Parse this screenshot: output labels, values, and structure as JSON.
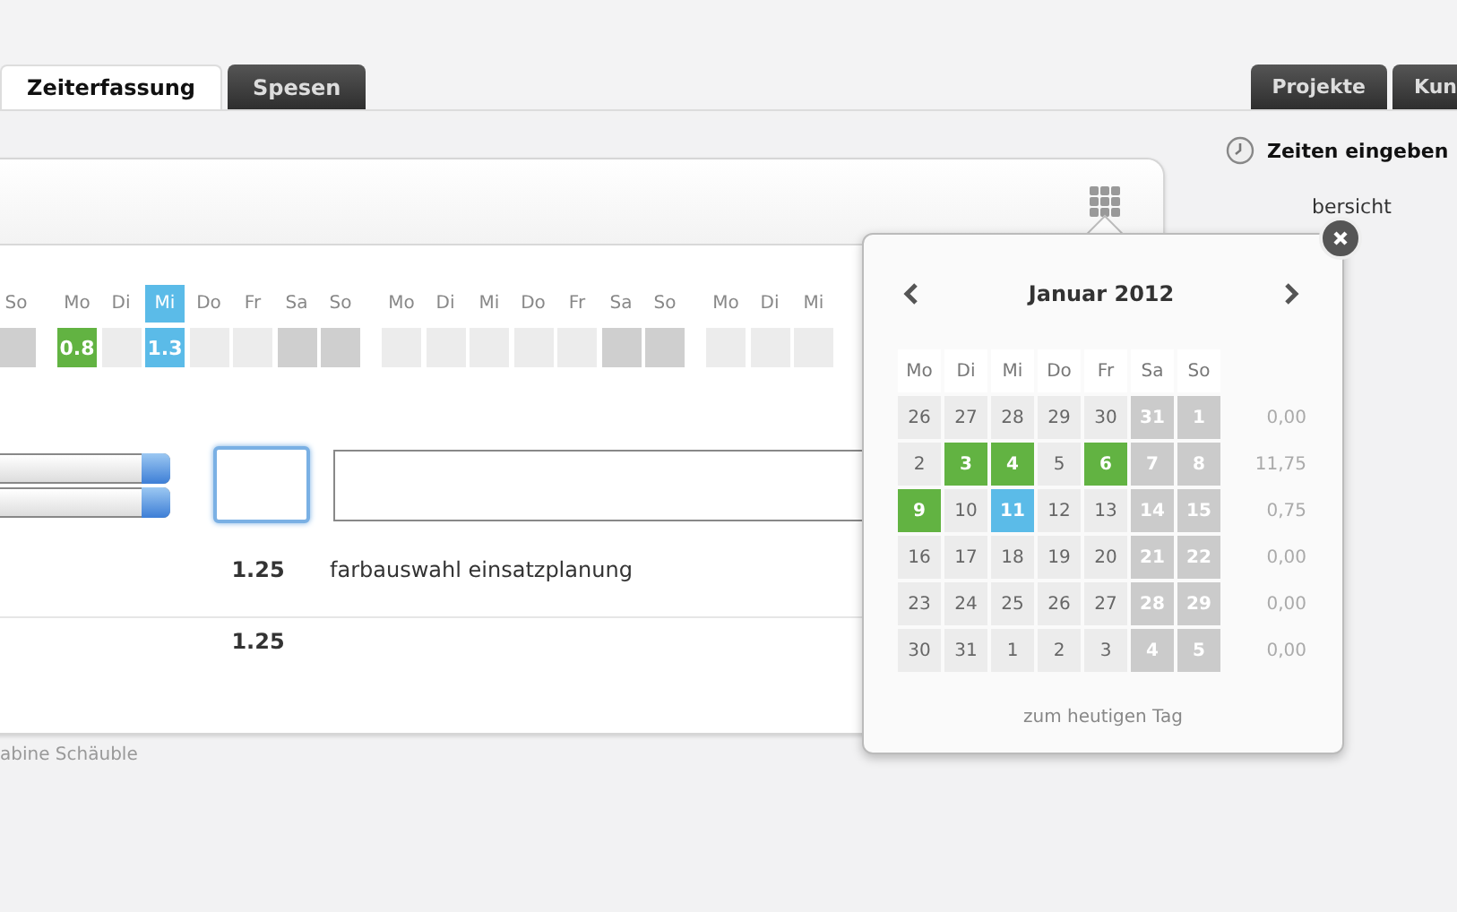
{
  "tabs_left": [
    {
      "label": "Zeiterfassung",
      "selected": true
    },
    {
      "label": "Spesen",
      "selected": false
    }
  ],
  "tabs_right": [
    {
      "label": "Projekte",
      "selected": false
    },
    {
      "label": "Kun",
      "selected": false
    }
  ],
  "week_strip": [
    {
      "days": [
        {
          "label": "So",
          "kind": "weekend"
        }
      ]
    },
    {
      "days": [
        {
          "label": "Mo",
          "kind": "booked",
          "value": "0.8"
        },
        {
          "label": "Di",
          "kind": "empty"
        },
        {
          "label": "Mi",
          "kind": "today",
          "value": "1.3"
        },
        {
          "label": "Do",
          "kind": "empty"
        },
        {
          "label": "Fr",
          "kind": "empty"
        },
        {
          "label": "Sa",
          "kind": "weekend"
        },
        {
          "label": "So",
          "kind": "weekend"
        }
      ]
    },
    {
      "days": [
        {
          "label": "Mo",
          "kind": "empty"
        },
        {
          "label": "Di",
          "kind": "empty"
        },
        {
          "label": "Mi",
          "kind": "empty"
        },
        {
          "label": "Do",
          "kind": "empty"
        },
        {
          "label": "Fr",
          "kind": "empty"
        },
        {
          "label": "Sa",
          "kind": "weekend"
        },
        {
          "label": "So",
          "kind": "weekend"
        }
      ]
    },
    {
      "days": [
        {
          "label": "Mo",
          "kind": "empty"
        },
        {
          "label": "Di",
          "kind": "empty"
        },
        {
          "label": "Mi",
          "kind": "empty"
        }
      ]
    }
  ],
  "entry_form": {
    "hours_focused": true
  },
  "entries": [
    {
      "hours": "1.25",
      "description": "farbauswahl einsatzplanung"
    }
  ],
  "total": "1.25",
  "footer": {
    "user": "abine Schäuble"
  },
  "sidebar": {
    "items": [
      {
        "label": "Zeiten eingeben",
        "selected": true,
        "kind": "clock"
      },
      {
        "label": "bersicht",
        "selected": false,
        "kind": "plain"
      }
    ]
  },
  "date_picker": {
    "month": "Januar 2012",
    "weekdays": [
      "Mo",
      "Di",
      "Mi",
      "Do",
      "Fr",
      "Sa",
      "So"
    ],
    "weeks": [
      {
        "days": [
          {
            "label": "26",
            "kind": "normal"
          },
          {
            "label": "27",
            "kind": "normal"
          },
          {
            "label": "28",
            "kind": "normal"
          },
          {
            "label": "29",
            "kind": "normal"
          },
          {
            "label": "30",
            "kind": "normal"
          },
          {
            "label": "31",
            "kind": "weekend"
          },
          {
            "label": "1",
            "kind": "weekend"
          }
        ],
        "total": "0,00"
      },
      {
        "days": [
          {
            "label": "2",
            "kind": "normal"
          },
          {
            "label": "3",
            "kind": "booked"
          },
          {
            "label": "4",
            "kind": "booked"
          },
          {
            "label": "5",
            "kind": "normal"
          },
          {
            "label": "6",
            "kind": "booked"
          },
          {
            "label": "7",
            "kind": "weekend"
          },
          {
            "label": "8",
            "kind": "weekend"
          }
        ],
        "total": "11,75"
      },
      {
        "days": [
          {
            "label": "9",
            "kind": "booked"
          },
          {
            "label": "10",
            "kind": "normal"
          },
          {
            "label": "11",
            "kind": "today"
          },
          {
            "label": "12",
            "kind": "normal"
          },
          {
            "label": "13",
            "kind": "normal"
          },
          {
            "label": "14",
            "kind": "weekend"
          },
          {
            "label": "15",
            "kind": "weekend"
          }
        ],
        "total": "0,75"
      },
      {
        "days": [
          {
            "label": "16",
            "kind": "normal"
          },
          {
            "label": "17",
            "kind": "normal"
          },
          {
            "label": "18",
            "kind": "normal"
          },
          {
            "label": "19",
            "kind": "normal"
          },
          {
            "label": "20",
            "kind": "normal"
          },
          {
            "label": "21",
            "kind": "weekend"
          },
          {
            "label": "22",
            "kind": "weekend"
          }
        ],
        "total": "0,00"
      },
      {
        "days": [
          {
            "label": "23",
            "kind": "normal"
          },
          {
            "label": "24",
            "kind": "normal"
          },
          {
            "label": "25",
            "kind": "normal"
          },
          {
            "label": "26",
            "kind": "normal"
          },
          {
            "label": "27",
            "kind": "normal"
          },
          {
            "label": "28",
            "kind": "weekend"
          },
          {
            "label": "29",
            "kind": "weekend"
          }
        ],
        "total": "0,00"
      },
      {
        "days": [
          {
            "label": "30",
            "kind": "normal"
          },
          {
            "label": "31",
            "kind": "normal"
          },
          {
            "label": "1",
            "kind": "normal"
          },
          {
            "label": "2",
            "kind": "normal"
          },
          {
            "label": "3",
            "kind": "normal"
          },
          {
            "label": "4",
            "kind": "weekend"
          },
          {
            "label": "5",
            "kind": "weekend"
          }
        ],
        "total": "0,00"
      }
    ],
    "today_link": "zum heutigen Tag"
  }
}
